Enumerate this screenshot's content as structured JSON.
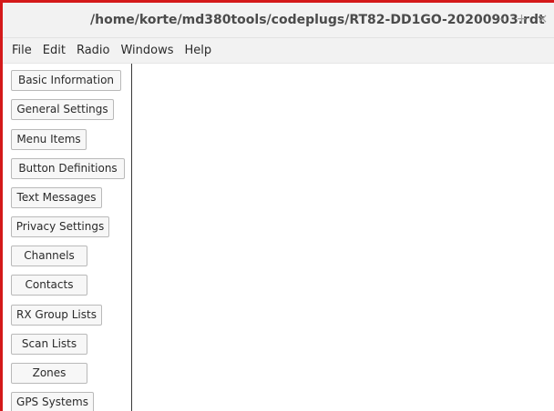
{
  "window": {
    "title": "/home/korte/md380tools/codeplugs/RT82-DD1GO-20200903.rdt",
    "controls": {
      "minimize": "–",
      "maximize": "+",
      "close": "×"
    }
  },
  "menubar": {
    "items": [
      "File",
      "Edit",
      "Radio",
      "Windows",
      "Help"
    ]
  },
  "nav": {
    "items": [
      "Basic Information",
      "General Settings",
      "Menu Items",
      "Button Definitions",
      "Text Messages",
      "Privacy Settings",
      "Channels",
      "Contacts",
      "RX Group Lists",
      "Scan Lists",
      "Zones",
      "GPS Systems"
    ]
  },
  "colors": {
    "border_accent": "#d4191a",
    "chrome_bg": "#f2f2f2"
  }
}
